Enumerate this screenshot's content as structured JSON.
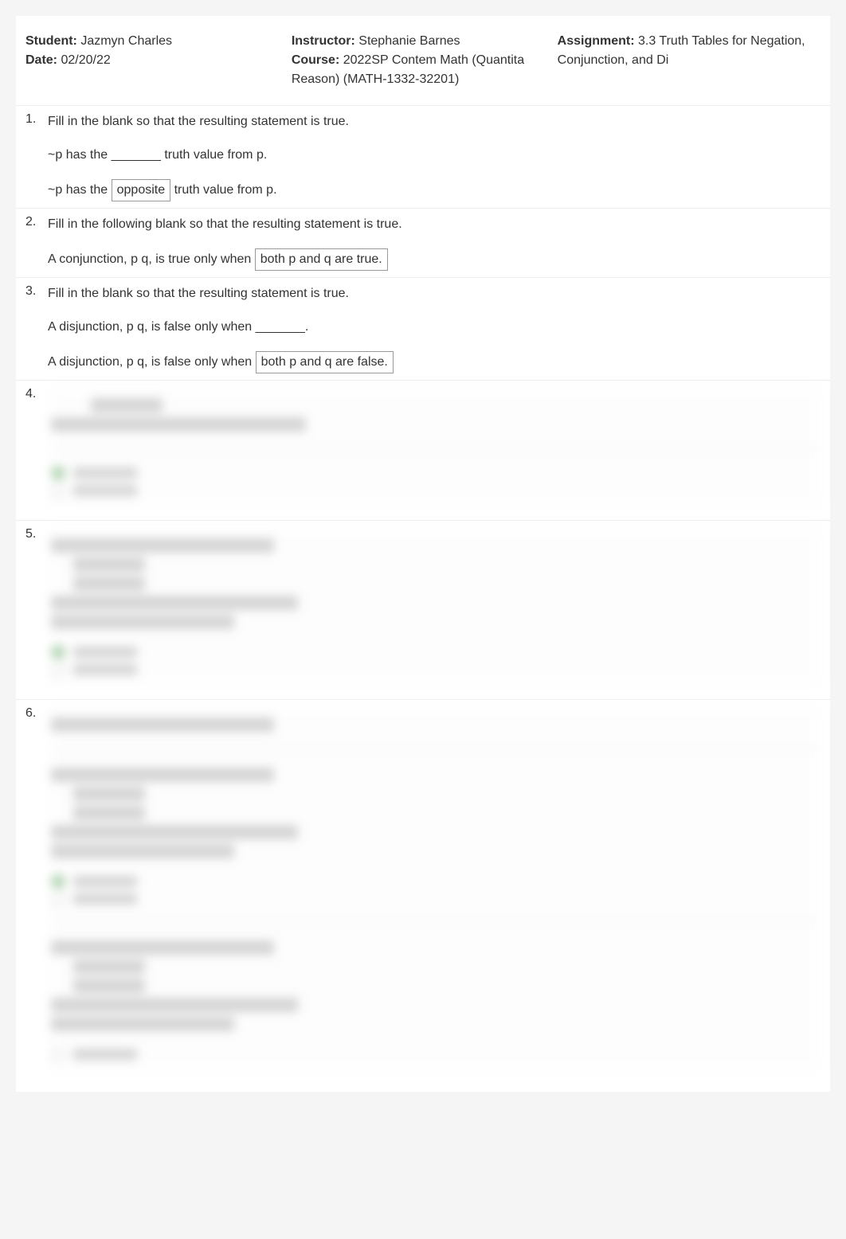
{
  "header": {
    "student_label": "Student:",
    "student_value": "Jazmyn Charles",
    "date_label": "Date:",
    "date_value": "02/20/22",
    "instructor_label": "Instructor:",
    "instructor_value": "Stephanie Barnes",
    "course_label": "Course:",
    "course_value": "2022SP Contem Math (Quantita Reason) (MATH-1332-32201)",
    "assignment_label": "Assignment:",
    "assignment_value": "3.3 Truth Tables for Negation, Conjunction, and Di"
  },
  "questions": [
    {
      "num": "1.",
      "prompt": "Fill in the blank so that the resulting statement is true.",
      "blank_text": "~p has the _______ truth value from p.",
      "answer_pre": "~p has the",
      "answer_boxed": "opposite",
      "answer_post": "truth value from p."
    },
    {
      "num": "2.",
      "prompt": "Fill in the following blank so that the resulting statement is true.",
      "answer_pre": "A conjunction, p",
      "answer_mid": "q, is true only when",
      "answer_boxed": "both p and q are true.",
      "answer_post": ""
    },
    {
      "num": "3.",
      "prompt": "Fill in the blank so that the resulting statement is true.",
      "blank_text": "A disjunction, p  q, is false only when _______.",
      "answer_pre": "A disjunction, p  q, is false only when",
      "answer_boxed": "both p and q are false.",
      "answer_post": ""
    },
    {
      "num": "4."
    },
    {
      "num": "5."
    },
    {
      "num": "6."
    }
  ]
}
